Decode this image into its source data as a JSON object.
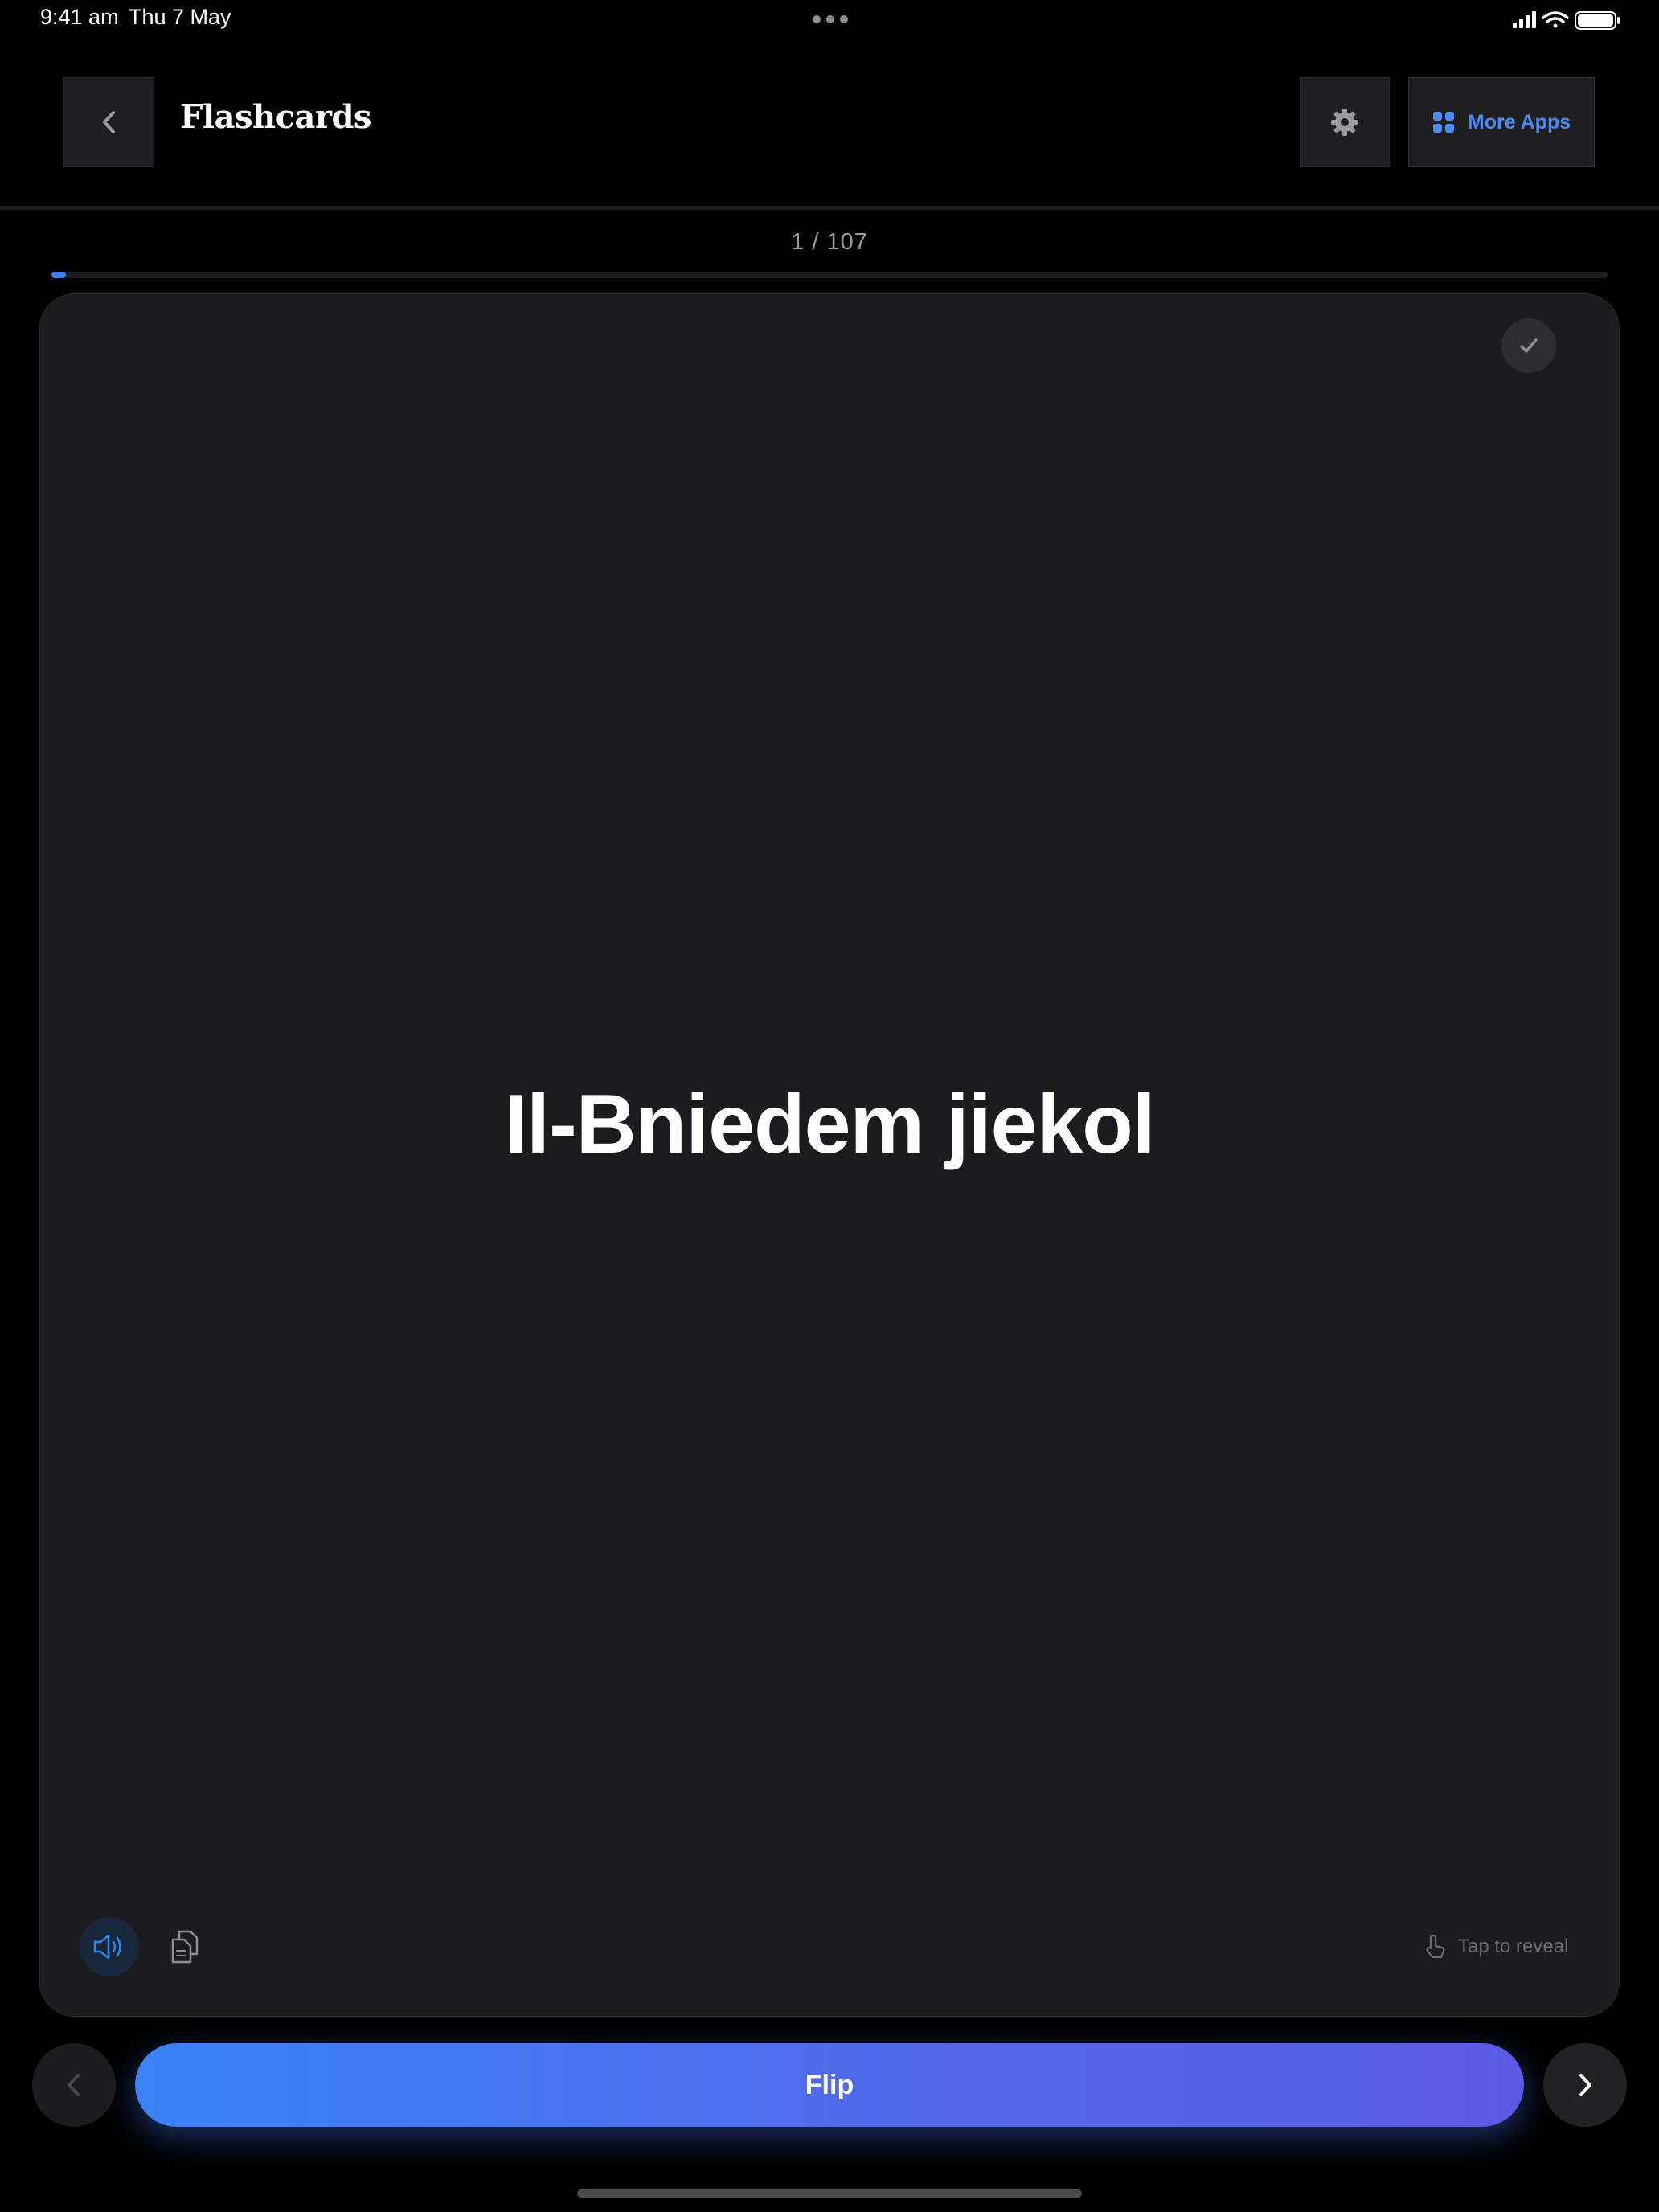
{
  "status_bar": {
    "time": "9:41 am",
    "date": "Thu 7 May"
  },
  "header": {
    "title": "Flashcards",
    "more_apps_label": "More Apps"
  },
  "progress": {
    "counter": "1 / 107",
    "current": 1,
    "total": 107,
    "fraction": 0.00935
  },
  "card": {
    "term": "Il-Bniedem jiekol",
    "hint": "Tap to reveal"
  },
  "controls": {
    "flip_label": "Flip"
  },
  "icons": {
    "back": "chevron-left-icon",
    "settings": "gear-icon",
    "more_apps": "grid-icon",
    "check": "checkmark-icon",
    "speaker": "speaker-icon",
    "copy": "copy-icon",
    "hint": "tap-hand-icon",
    "prev": "chevron-left-icon",
    "next": "chevron-right-icon"
  },
  "colors": {
    "background": "#000000",
    "card": "#1c1c1e",
    "accent": "#3d7cf2",
    "flip_gradient_start": "#3a82f6",
    "flip_gradient_end": "#5b5ae4"
  }
}
